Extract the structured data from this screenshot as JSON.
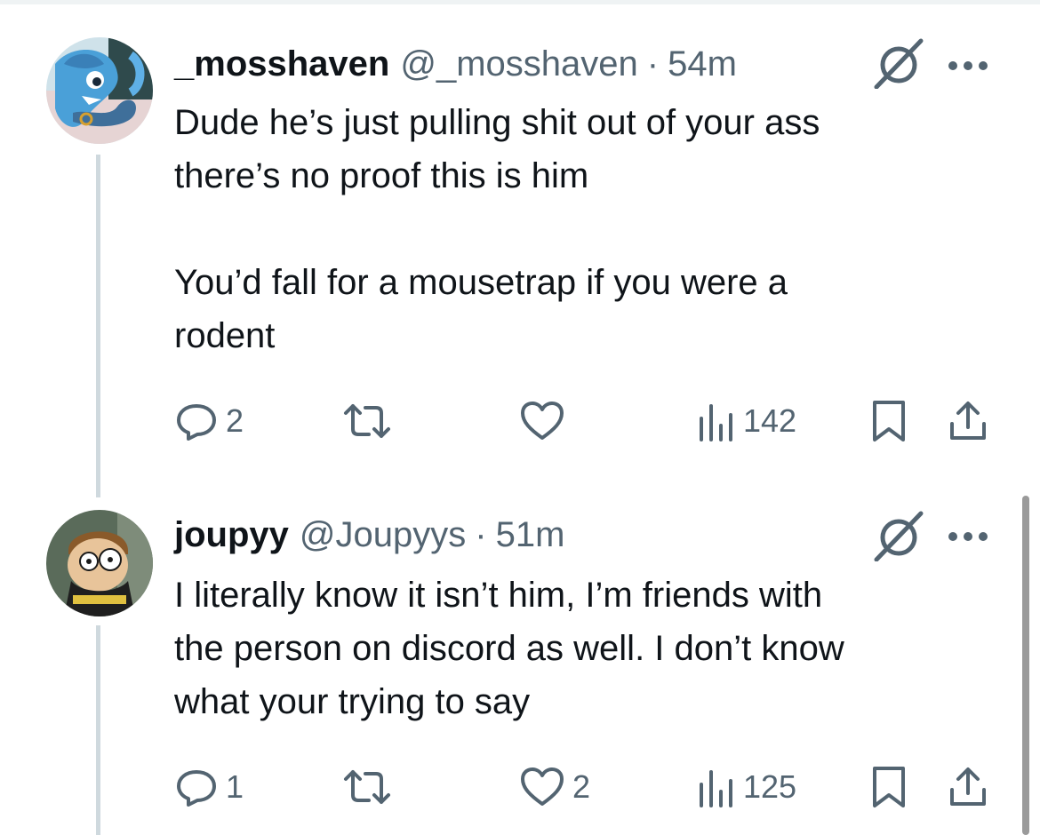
{
  "colors": {
    "text": "#0f1419",
    "secondary": "#536471",
    "thread_line": "#cfd9de",
    "divider": "#eff3f4"
  },
  "tweets": [
    {
      "display_name": "_mosshaven",
      "handle": "@_mosshaven",
      "separator": "·",
      "time": "54m",
      "avatar_icon": "blue-creature-avatar",
      "text": "Dude he’s just pulling shit out of your ass\nthere’s no proof this is him\n\nYou’d fall for a mousetrap if you were a\nrodent",
      "replies": "2",
      "reposts": "",
      "likes": "",
      "views": "142"
    },
    {
      "display_name": "joupyy",
      "handle": "@Joupyys",
      "separator": "·",
      "time": "51m",
      "avatar_icon": "cartoon-boy-avatar",
      "text": "I literally know it isn’t him, I’m friends with\nthe person on discord as well. I don’t know\nwhat your trying to say",
      "replies": "1",
      "reposts": "",
      "likes": "2",
      "views": "125"
    }
  ]
}
